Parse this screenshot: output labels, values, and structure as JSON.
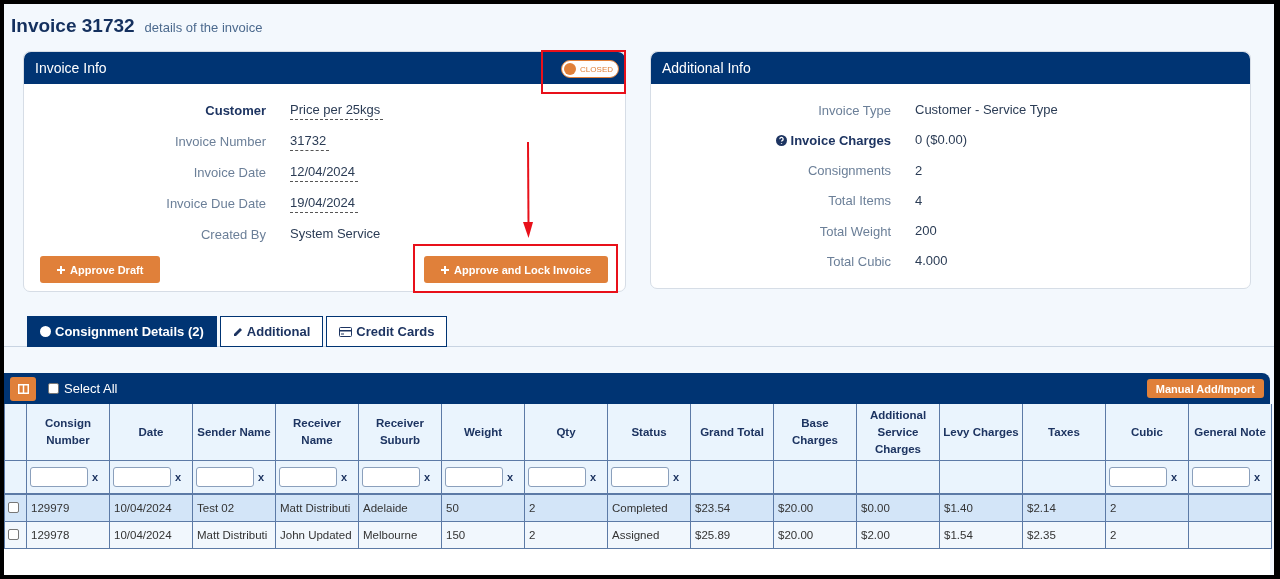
{
  "header": {
    "title": "Invoice 31732",
    "subtitle": "details of the invoice"
  },
  "invoice_info": {
    "title": "Invoice Info",
    "status_toggle": {
      "label": "CLOSED",
      "on": false,
      "highlighted": true
    },
    "fields": [
      {
        "label": "Customer",
        "value": "Price per 25kgs",
        "emphasis": true,
        "editable": true
      },
      {
        "label": "Invoice Number",
        "value": "31732",
        "emphasis": false,
        "editable": true
      },
      {
        "label": "Invoice Date",
        "value": "12/04/2024",
        "emphasis": false,
        "editable": true
      },
      {
        "label": "Invoice Due Date",
        "value": "19/04/2024",
        "emphasis": false,
        "editable": true
      },
      {
        "label": "Created By",
        "value": "System Service",
        "emphasis": false,
        "editable": false
      }
    ],
    "buttons": [
      {
        "label": "Approve Draft",
        "highlighted": false
      },
      {
        "label": "Approve and Lock Invoice",
        "highlighted": true
      }
    ]
  },
  "additional_info": {
    "title": "Additional Info",
    "fields": [
      {
        "label": "Invoice Type",
        "value": "Customer - Service Type",
        "emphasis": false
      },
      {
        "label": "Invoice Charges",
        "value": "0 ($0.00)",
        "emphasis": true
      },
      {
        "label": "Consignments",
        "value": "2",
        "emphasis": false
      },
      {
        "label": "Total Items",
        "value": "4",
        "emphasis": false
      },
      {
        "label": "Total Weight",
        "value": "200",
        "emphasis": false
      },
      {
        "label": "Total Cubic",
        "value": "4.000",
        "emphasis": false
      }
    ]
  },
  "tabs": [
    {
      "label": "Consignment Details (2)",
      "kind": "circle",
      "selected": true
    },
    {
      "label": "Additional",
      "kind": "pencil",
      "selected": false
    },
    {
      "label": "Credit Cards",
      "kind": "card",
      "selected": false
    }
  ],
  "table": {
    "select_all": {
      "label": "Select All",
      "checked": false
    },
    "action_button": "Manual Add/Import",
    "columns": [
      {
        "label": "Consign Number",
        "filter": true,
        "filter_clear": "x"
      },
      {
        "label": "Date",
        "filter": true,
        "filter_clear": "x"
      },
      {
        "label": "Sender Name",
        "filter": true,
        "filter_clear": "x"
      },
      {
        "label": "Receiver Name",
        "filter": true,
        "filter_clear": "x"
      },
      {
        "label": "Receiver Suburb",
        "filter": true,
        "filter_clear": "x"
      },
      {
        "label": "Weight",
        "filter": true,
        "filter_clear": "x"
      },
      {
        "label": "Qty",
        "filter": true,
        "filter_clear": "x"
      },
      {
        "label": "Status",
        "filter": true,
        "filter_clear": "x"
      },
      {
        "label": "Grand Total",
        "filter": false
      },
      {
        "label": "Base Charges",
        "filter": false
      },
      {
        "label": "Additional Service Charges",
        "filter": false
      },
      {
        "label": "Levy Charges",
        "filter": false
      },
      {
        "label": "Taxes",
        "filter": false
      },
      {
        "label": "Cubic",
        "filter": true,
        "filter_clear": "x"
      },
      {
        "label": "General Note",
        "filter": true,
        "filter_clear": "x"
      }
    ],
    "rows": [
      {
        "selected": true,
        "checked": false,
        "cells": [
          "129979",
          "10/04/2024",
          "Test 02",
          "Matt Distributi",
          "Adelaide",
          "50",
          "2",
          "Completed",
          "$23.54",
          "$20.00",
          "$0.00",
          "$1.40",
          "$2.14",
          "2",
          ""
        ]
      },
      {
        "selected": false,
        "checked": false,
        "cells": [
          "129978",
          "10/04/2024",
          "Matt Distributi",
          "John Updated",
          "Melbourne",
          "150",
          "2",
          "Assigned",
          "$25.89",
          "$20.00",
          "$2.00",
          "$1.54",
          "$2.35",
          "2",
          ""
        ]
      }
    ]
  }
}
